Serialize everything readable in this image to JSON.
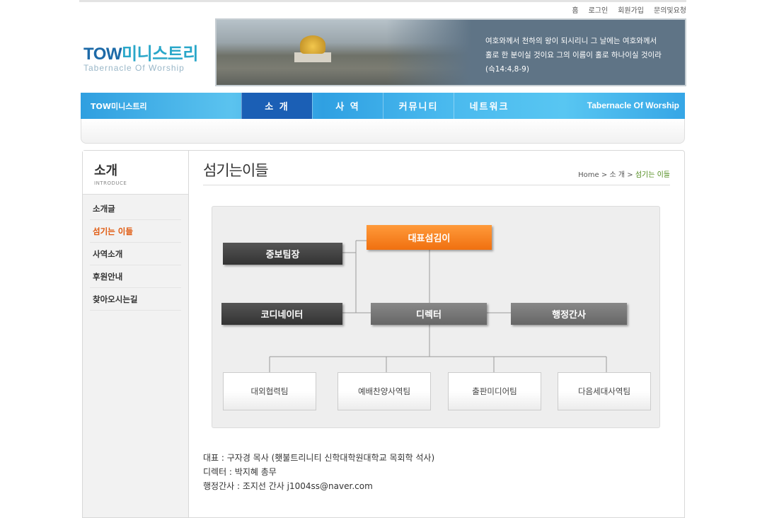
{
  "util_nav": [
    "홈",
    "로그인",
    "회원가입",
    "문의및요청"
  ],
  "logo": {
    "main_tow": "TOW",
    "main_ko": "미니스트리",
    "sub": "Tabernacle Of Worship"
  },
  "banner": {
    "verse_line1": "여호와께서 천하의 왕이 되시리니 그 날에는 여호와께서",
    "verse_line2": "홀로 한 분이실 것이요 그의 이름이 홀로 하나이실 것이라",
    "verse_line3": "(슥14:4,8-9)"
  },
  "gnb": {
    "brand": "TOW미니스트리",
    "items": [
      "소 개",
      "사 역",
      "커뮤니티",
      "네트워크"
    ],
    "right": "Tabernacle Of Worship"
  },
  "lnb": {
    "title": "소개",
    "subtitle": "INTRODUCE",
    "items": [
      "소개글",
      "섬기는 이들",
      "사역소개",
      "후원안내",
      "찾아오시는길"
    ]
  },
  "content": {
    "title": "섬기는이들",
    "crumb": [
      "Home",
      "소 개",
      "섬기는 이들"
    ]
  },
  "org": {
    "leader": "대표섬김이",
    "intercession": "중보팀장",
    "coordinator": "코디네이터",
    "director": "디렉터",
    "admin": "행정간사",
    "teams": [
      "대외협력팀",
      "예배찬양사역팀",
      "출판미디어팀",
      "다음세대사역팀"
    ]
  },
  "info": {
    "line1": "대표 : 구자경 목사 (횃불트리니티 신학대학원대학교 목회학 석사)",
    "line2": "디렉터 : 박지혜 총무",
    "line3": "행정간사 : 조지선 간사 j1004ss@naver.com"
  },
  "colors": {
    "accent": "#f07010",
    "nav_blue": "#2fa0e2",
    "active_nav": "#1b5fb5",
    "lnb_active": "#e05a10"
  }
}
